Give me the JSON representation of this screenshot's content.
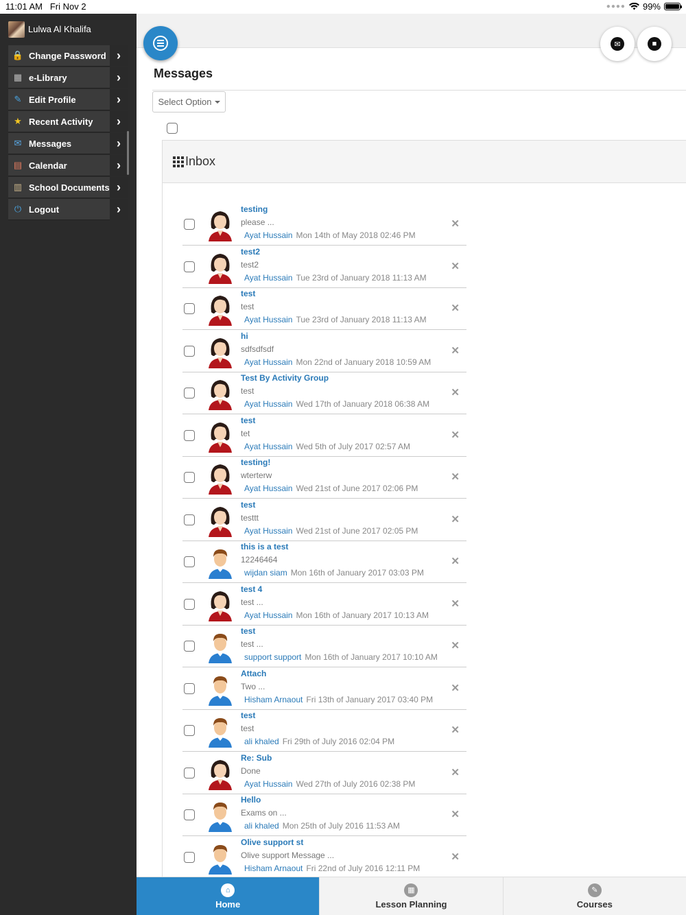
{
  "status_bar": {
    "time": "11:01 AM",
    "date": "Fri Nov 2",
    "battery": "99%",
    "battery_level": 0.99
  },
  "sidebar": {
    "user_name": "Lulwa Al Khalifa",
    "items": [
      {
        "label": "Change Password",
        "icon": "lock-icon"
      },
      {
        "label": "e-Library",
        "icon": "library-icon"
      },
      {
        "label": "Edit Profile",
        "icon": "edit-icon"
      },
      {
        "label": "Recent Activity",
        "icon": "star-icon"
      },
      {
        "label": "Messages",
        "icon": "mail-icon"
      },
      {
        "label": "Calendar",
        "icon": "calendar-icon"
      },
      {
        "label": "School Documents",
        "icon": "document-icon"
      },
      {
        "label": "Logout",
        "icon": "power-icon"
      }
    ]
  },
  "header": {
    "title": "Messages"
  },
  "toolbar": {
    "select_label": "Select Option"
  },
  "inbox": {
    "title": "Inbox",
    "messages": [
      {
        "subject": "testing",
        "preview": "please ...",
        "sender": "Ayat Hussain",
        "date": "Mon 14th of May 2018 02:46 PM",
        "avatar": "female"
      },
      {
        "subject": "test2",
        "preview": "test2",
        "sender": "Ayat Hussain",
        "date": "Tue 23rd of January 2018 11:13 AM",
        "avatar": "female"
      },
      {
        "subject": "test",
        "preview": "test",
        "sender": "Ayat Hussain",
        "date": "Tue 23rd of January 2018 11:13 AM",
        "avatar": "female"
      },
      {
        "subject": "hi",
        "preview": "sdfsdfsdf",
        "sender": "Ayat Hussain",
        "date": "Mon 22nd of January 2018 10:59 AM",
        "avatar": "female"
      },
      {
        "subject": "Test By Activity Group",
        "preview": "test",
        "sender": "Ayat Hussain",
        "date": "Wed 17th of January 2018 06:38 AM",
        "avatar": "female"
      },
      {
        "subject": "test",
        "preview": "tet",
        "sender": "Ayat Hussain",
        "date": "Wed 5th of July 2017 02:57 AM",
        "avatar": "female"
      },
      {
        "subject": "testing!",
        "preview": "wterterw",
        "sender": "Ayat Hussain",
        "date": "Wed 21st of June 2017 02:06 PM",
        "avatar": "female"
      },
      {
        "subject": "test",
        "preview": "testtt",
        "sender": "Ayat Hussain",
        "date": "Wed 21st of June 2017 02:05 PM",
        "avatar": "female"
      },
      {
        "subject": "this is a test",
        "preview": "12246464",
        "sender": "wijdan siam",
        "date": "Mon 16th of January 2017 03:03 PM",
        "avatar": "male"
      },
      {
        "subject": "test 4",
        "preview": "test ...",
        "sender": "Ayat Hussain",
        "date": "Mon 16th of January 2017 10:13 AM",
        "avatar": "female"
      },
      {
        "subject": "test",
        "preview": "test ...",
        "sender": "support support",
        "date": "Mon 16th of January 2017 10:10 AM",
        "avatar": "male"
      },
      {
        "subject": "Attach",
        "preview": "Two ...",
        "sender": "Hisham Arnaout",
        "date": "Fri 13th of January 2017 03:40 PM",
        "avatar": "male"
      },
      {
        "subject": "test",
        "preview": "test",
        "sender": "ali khaled",
        "date": "Fri 29th of July 2016 02:04 PM",
        "avatar": "male"
      },
      {
        "subject": "Re: Sub",
        "preview": "Done",
        "sender": "Ayat Hussain",
        "date": "Wed 27th of July 2016 02:38 PM",
        "avatar": "female"
      },
      {
        "subject": "Hello",
        "preview": "Exams on ...",
        "sender": "ali khaled",
        "date": "Mon 25th of July 2016 11:53 AM",
        "avatar": "male"
      },
      {
        "subject": "Olive support st",
        "preview": "Olive support Message ...",
        "sender": "Hisham Arnaout",
        "date": "Fri 22nd of July 2016 12:11 PM",
        "avatar": "male"
      }
    ]
  },
  "tabs": [
    {
      "label": "Home",
      "icon": "home-icon",
      "active": true
    },
    {
      "label": "Lesson Planning",
      "icon": "calendar-icon",
      "active": false
    },
    {
      "label": "Courses",
      "icon": "pencil-icon",
      "active": false
    }
  ],
  "colors": {
    "accent": "#2a87c8",
    "link": "#2a7ab8",
    "sidebar": "#2b2b2b"
  }
}
